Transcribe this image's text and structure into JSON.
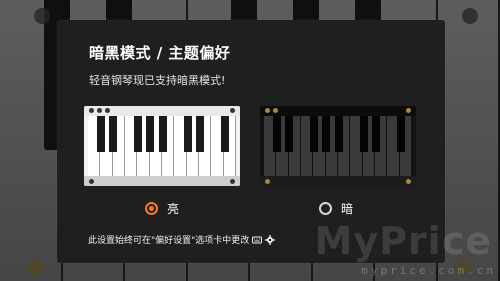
{
  "dialog": {
    "title": "暗黑模式 / 主题偏好",
    "subtitle": "轻音钢琴现已支持暗黑模式!",
    "options": [
      {
        "label": "亮",
        "selected": true
      },
      {
        "label": "暗",
        "selected": false
      }
    ],
    "footer_text": "此设置始终可在\"偏好设置\"选项卡中更改",
    "footer_icons": [
      "keyboard-icon",
      "gear-icon"
    ]
  },
  "watermark": {
    "main": "MyPrice",
    "sub": "myprice.com.cn"
  },
  "colors": {
    "accent": "#f07a2a",
    "dialog_bg": "#1f1f1f"
  }
}
